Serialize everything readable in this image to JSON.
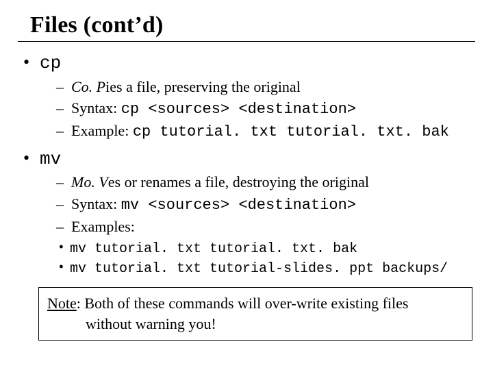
{
  "title": "Files (cont’d)",
  "cp": {
    "cmd": "cp",
    "desc_pre": "Co. P",
    "desc_post": "ies a file, preserving the original",
    "syntax_label": "Syntax: ",
    "syntax_code": "cp <sources> <destination>",
    "example_label": "Example: ",
    "example_code": "cp tutorial. txt tutorial. txt. bak"
  },
  "mv": {
    "cmd": "mv",
    "desc_pre": "Mo. V",
    "desc_post": "es or renames a file, destroying the original",
    "syntax_label": "Syntax: ",
    "syntax_code": "mv <sources> <destination>",
    "examples_label": "Examples:",
    "ex1": "mv tutorial. txt tutorial. txt. bak",
    "ex2": "mv tutorial. txt tutorial-slides. ppt backups/"
  },
  "note": {
    "label": "Note",
    "line1": ": Both of these commands will over-write existing files",
    "line2": "without warning you!"
  }
}
